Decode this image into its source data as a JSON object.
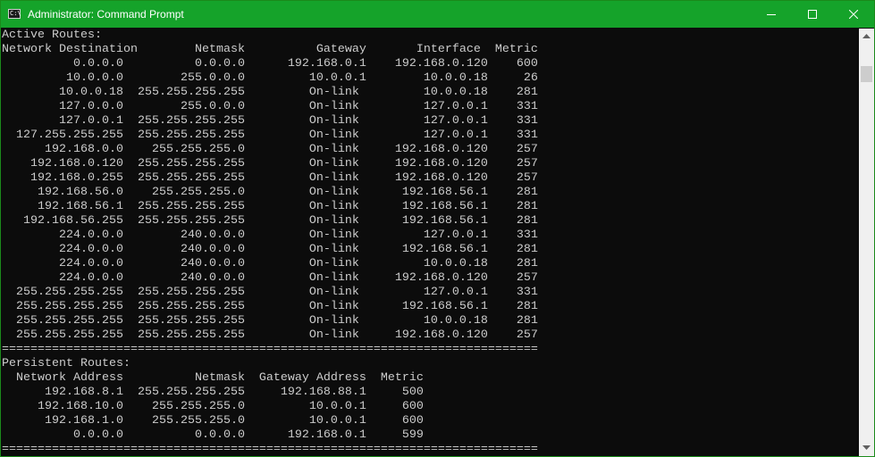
{
  "window": {
    "title": "Administrator: Command Prompt",
    "icon": "cmd-icon",
    "icon_text": "C:\\",
    "accent_color": "#15a32a"
  },
  "controls": {
    "minimize_icon": "minimize-icon",
    "maximize_icon": "maximize-icon",
    "close_icon": "close-icon"
  },
  "console": {
    "foreground": "#cccccc",
    "background": "#0c0c0c",
    "lines": [
      "Active Routes:",
      "Network Destination        Netmask          Gateway       Interface  Metric",
      "          0.0.0.0          0.0.0.0      192.168.0.1    192.168.0.120    600",
      "         10.0.0.0        255.0.0.0         10.0.0.1        10.0.0.18     26",
      "        10.0.0.18  255.255.255.255         On-link         10.0.0.18    281",
      "        127.0.0.0        255.0.0.0         On-link         127.0.0.1    331",
      "        127.0.0.1  255.255.255.255         On-link         127.0.0.1    331",
      "  127.255.255.255  255.255.255.255         On-link         127.0.0.1    331",
      "      192.168.0.0    255.255.255.0         On-link     192.168.0.120    257",
      "    192.168.0.120  255.255.255.255         On-link     192.168.0.120    257",
      "    192.168.0.255  255.255.255.255         On-link     192.168.0.120    257",
      "     192.168.56.0    255.255.255.0         On-link      192.168.56.1    281",
      "     192.168.56.1  255.255.255.255         On-link      192.168.56.1    281",
      "   192.168.56.255  255.255.255.255         On-link      192.168.56.1    281",
      "        224.0.0.0        240.0.0.0         On-link         127.0.0.1    331",
      "        224.0.0.0        240.0.0.0         On-link      192.168.56.1    281",
      "        224.0.0.0        240.0.0.0         On-link         10.0.0.18    281",
      "        224.0.0.0        240.0.0.0         On-link     192.168.0.120    257",
      "  255.255.255.255  255.255.255.255         On-link         127.0.0.1    331",
      "  255.255.255.255  255.255.255.255         On-link      192.168.56.1    281",
      "  255.255.255.255  255.255.255.255         On-link         10.0.0.18    281",
      "  255.255.255.255  255.255.255.255         On-link     192.168.0.120    257",
      "===========================================================================",
      "Persistent Routes:",
      "  Network Address          Netmask  Gateway Address  Metric",
      "      192.168.8.1  255.255.255.255     192.168.88.1     500",
      "     192.168.10.0    255.255.255.0         10.0.0.1     600",
      "      192.168.1.0    255.255.255.0         10.0.0.1     600",
      "          0.0.0.0          0.0.0.0      192.168.0.1     599",
      "==========================================================================="
    ]
  },
  "scrollbar": {
    "up_icon": "scroll-up-arrow-icon",
    "down_icon": "scroll-down-arrow-icon"
  }
}
